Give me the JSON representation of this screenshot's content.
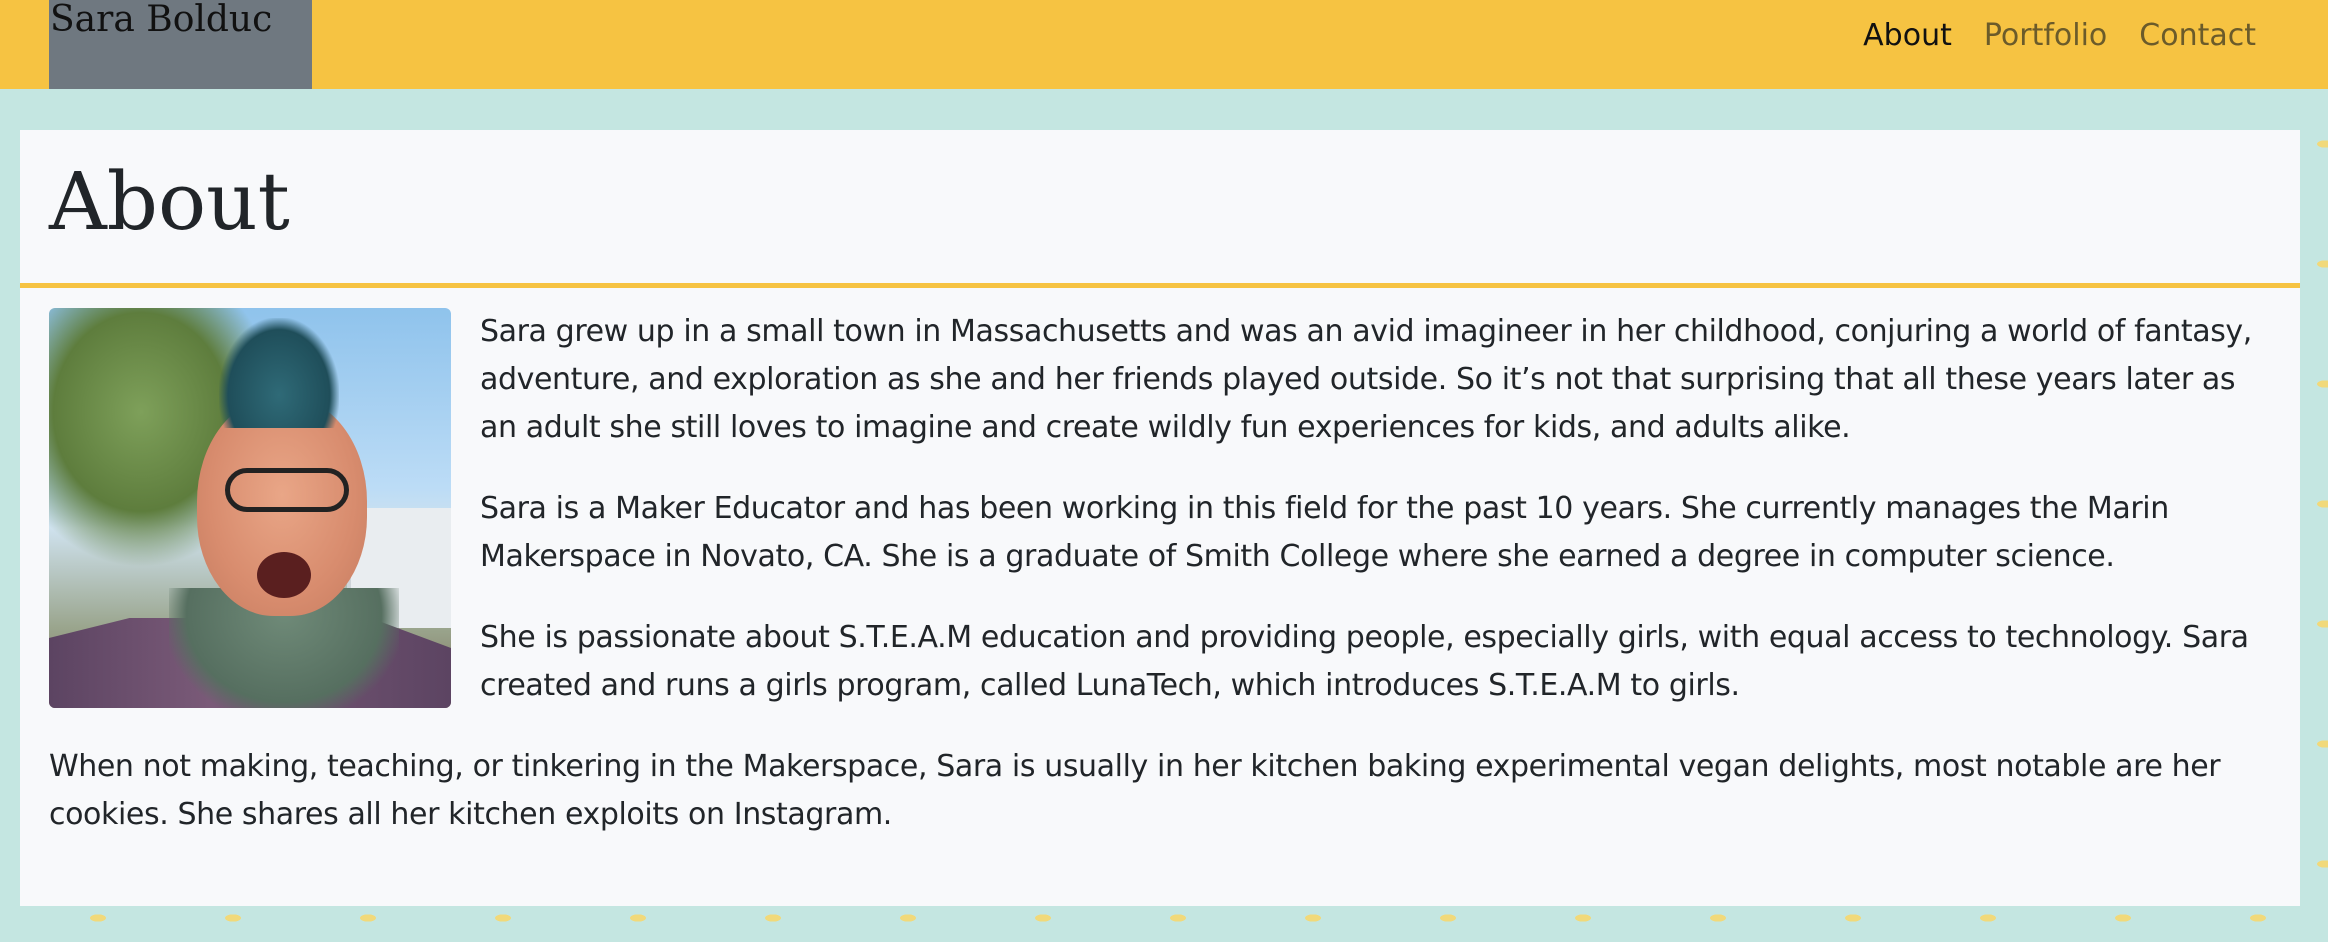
{
  "navbar": {
    "brand": "Sara Bolduc",
    "links": [
      {
        "label": "About",
        "active": true
      },
      {
        "label": "Portfolio",
        "active": false
      },
      {
        "label": "Contact",
        "active": false
      }
    ]
  },
  "page": {
    "title": "About",
    "photo_alt": "Sara Bolduc",
    "paragraphs": [
      "Sara grew up in a small town in Massachusetts and was an avid imagineer in her childhood, conjuring a world of fantasy, adventure, and exploration as she and her friends played outside. So it’s not that surprising that all these years later as an adult she still loves to imagine and create wildly fun experiences for kids, and adults alike.",
      "Sara is a Maker Educator and has been working in this field for the past 10 years. She currently manages the Marin Makerspace in Novato, CA. She is a graduate of Smith College where she earned a degree in computer science.",
      "She is passionate about S.T.E.A.M education and providing people, especially girls, with equal access to technology. Sara created and runs a girls program, called LunaTech, which introduces S.T.E.A.M to girls.",
      "When not making, teaching, or tinkering in the Makerspace, Sara is usually in her kitchen baking experimental vegan delights, most notable are her cookies. She shares all her kitchen exploits on Instagram."
    ]
  },
  "colors": {
    "navbar": "#f6c342",
    "brand_bg": "#6f7880",
    "background": "#c4e6e1",
    "card": "#f8f9fb",
    "accent_rule": "#f6c342"
  }
}
